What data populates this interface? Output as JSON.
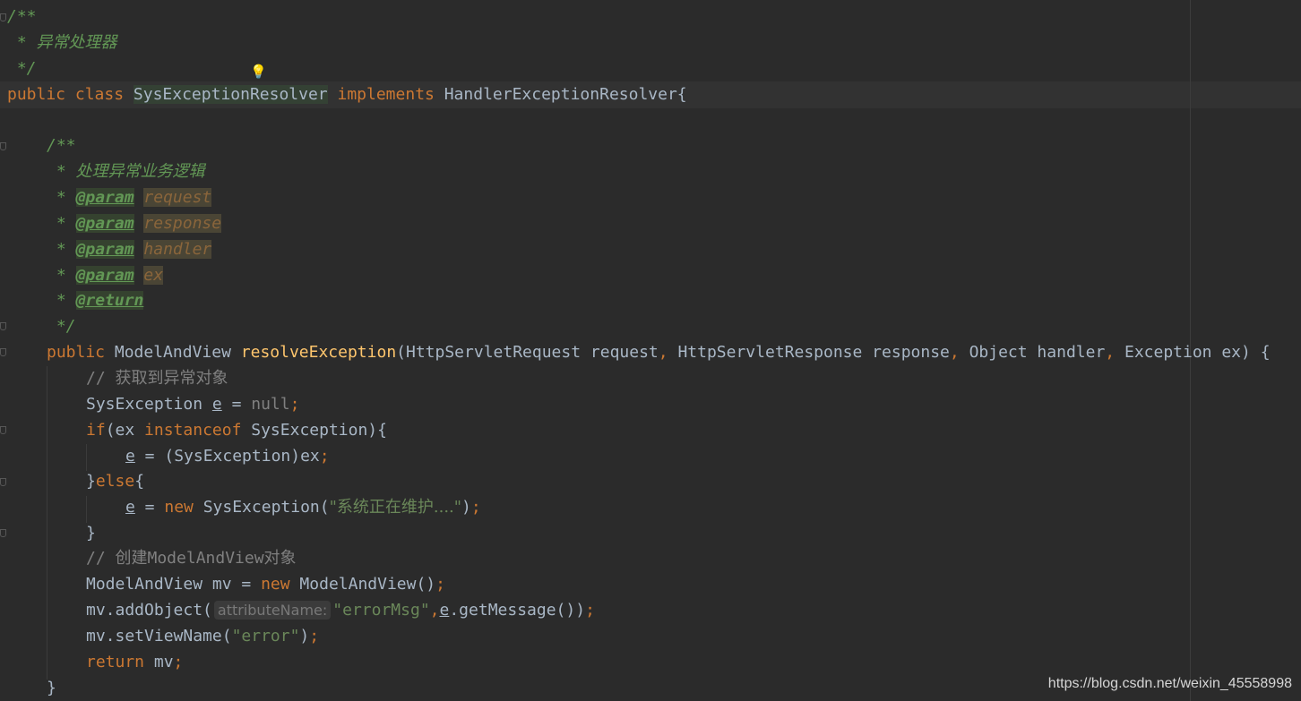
{
  "editor": {
    "watermark": "https://blog.csdn.net/weixin_45558998",
    "inlay_hint": "attributeName:",
    "colors": {
      "background": "#2b2b2b",
      "keyword": "#cc7832",
      "doc_comment": "#629755",
      "string": "#6a8759",
      "method": "#ffc66d",
      "line_comment": "#808080",
      "identifier": "#a9b7c6"
    },
    "icons": [
      "intention-bulb-icon",
      "fold-marker-icon"
    ]
  },
  "code": {
    "class_doc_open": "/**",
    "class_doc_text": " * 异常处理器",
    "class_doc_close": " */",
    "kw_public": "public",
    "kw_class": "class",
    "class_name": "SysExceptionResolver",
    "kw_implements": "implements",
    "interface_decl": "HandlerExceptionResolver{",
    "method_doc_open": "/**",
    "method_doc_text": " * 处理异常业务逻辑",
    "doc_star": " * ",
    "tag_param": "@param",
    "tag_return": "@return",
    "param_request": "request",
    "param_response": "response",
    "param_handler": "handler",
    "param_ex": "ex",
    "method_doc_close": " */",
    "return_type": "ModelAndView",
    "method_name": "resolveException",
    "sig_part1": "(HttpServletRequest request",
    "sig_part2": " HttpServletResponse response",
    "sig_part3": " Object handler",
    "sig_part4": " Exception ex) {",
    "comma": ",",
    "semicolon": ";",
    "comment_get_exception": "// 获取到异常对象",
    "type_sys_exception": "SysException",
    "var_e": "e",
    "assign": " = ",
    "kw_null": "null",
    "kw_if": "if",
    "if_cond_open": "(ex ",
    "kw_instanceof": "instanceof",
    "if_cond_close": " SysException){",
    "cast_expr": "(SysException)ex",
    "else_open_brace": "}",
    "kw_else": "else",
    "else_brace": "{",
    "kw_new": "new",
    "new_sys_exception": " SysException(",
    "string_maintenance": "\"系统正在维护....\"",
    "close_paren": ")",
    "close_brace": "}",
    "comment_create_mav": "// 创建ModelAndView对象",
    "mav_decl": "ModelAndView mv = ",
    "mav_ctor": " ModelAndView()",
    "add_object_open": "mv.addObject(",
    "string_error_msg": "\"errorMsg\"",
    "get_message": ".getMessage())",
    "set_view_open": "mv.setViewName(",
    "string_error": "\"error\"",
    "kw_return": "return",
    "return_value": " mv",
    "method_close": "}"
  }
}
